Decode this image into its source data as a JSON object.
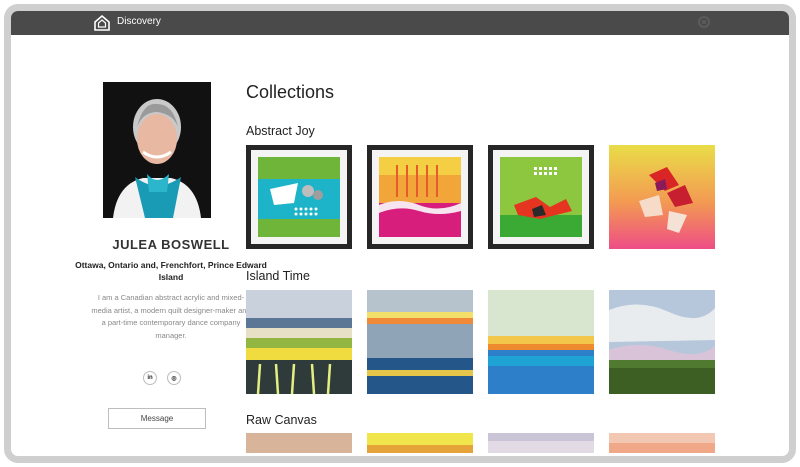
{
  "topbar": {
    "brand": "Discovery",
    "icons": {
      "logo": "house-logo-icon",
      "settings": "gear-icon"
    }
  },
  "profile": {
    "name": "JULEA BOSWELL",
    "location": "Ottawa, Ontario and, Frenchfort, Prince Edward Island",
    "bio": "I am a Canadian abstract acrylic and mixed-media artist, a modern quilt designer-maker and a part-time contemporary dance company manager.",
    "social": [
      {
        "name": "linkedin-icon",
        "label": "in"
      },
      {
        "name": "instagram-icon",
        "label": "◎"
      }
    ],
    "message_label": "Message"
  },
  "main": {
    "heading": "Collections",
    "collections": [
      {
        "title": "Abstract Joy"
      },
      {
        "title": "Island Time"
      },
      {
        "title": "Raw Canvas"
      }
    ]
  }
}
